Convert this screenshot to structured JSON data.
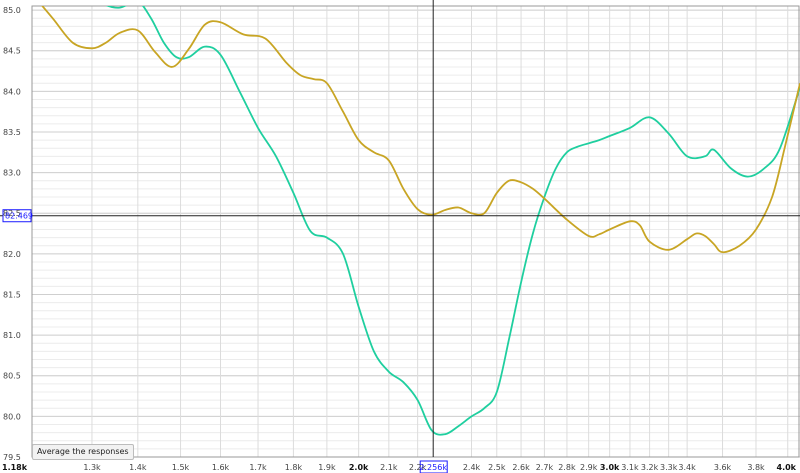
{
  "button": {
    "average_label": "Average the responses"
  },
  "cursor": {
    "x_label": "2.256k",
    "y_label": "82.469",
    "x": 2256,
    "y": 82.469
  },
  "colors": {
    "teal": "#1fcf9f",
    "gold": "#c8a524",
    "cursor_label": "#1a1aff"
  },
  "chart_data": {
    "type": "line",
    "x_scale": "log",
    "xlim": [
      1180,
      4080
    ],
    "ylim": [
      79.5,
      85.05
    ],
    "grid": true,
    "ytick_values": [
      79.5,
      80.0,
      80.5,
      81.0,
      81.5,
      82.0,
      82.5,
      83.0,
      83.5,
      84.0,
      84.5,
      85.0
    ],
    "ytick_labels": [
      "79.5",
      "80.0",
      "80.5",
      "81.0",
      "81.5",
      "82.0",
      "82.5",
      "83.0",
      "83.5",
      "84.0",
      "84.5",
      "85.0"
    ],
    "xtick_values": [
      1180,
      1300,
      1400,
      1500,
      1600,
      1700,
      1800,
      1900,
      2000,
      2100,
      2200,
      2400,
      2500,
      2600,
      2700,
      2800,
      2900,
      3000,
      3100,
      3200,
      3300,
      3400,
      3600,
      3800,
      4000
    ],
    "xtick_labels": [
      "1.18k",
      "1.3k",
      "1.4k",
      "1.5k",
      "1.6k",
      "1.7k",
      "1.8k",
      "1.9k",
      "2.0k",
      "2.1k",
      "2.2k",
      "2.4k",
      "2.5k",
      "2.6k",
      "2.7k",
      "2.8k",
      "2.9k",
      "3.0k",
      "3.1k",
      "3.2k",
      "3.3k",
      "3.4k",
      "3.6k",
      "3.8k",
      "4.0k"
    ],
    "xtick_major": [
      1180,
      2000,
      3000,
      4000
    ],
    "series": [
      {
        "color": "#1fcf9f",
        "points": [
          [
            1300,
            85.15
          ],
          [
            1330,
            85.06
          ],
          [
            1360,
            85.03
          ],
          [
            1400,
            85.1
          ],
          [
            1430,
            84.9
          ],
          [
            1460,
            84.6
          ],
          [
            1490,
            84.42
          ],
          [
            1520,
            84.42
          ],
          [
            1560,
            84.55
          ],
          [
            1600,
            84.45
          ],
          [
            1650,
            84.0
          ],
          [
            1700,
            83.55
          ],
          [
            1750,
            83.2
          ],
          [
            1800,
            82.75
          ],
          [
            1850,
            82.28
          ],
          [
            1900,
            82.2
          ],
          [
            1950,
            82.0
          ],
          [
            2000,
            81.35
          ],
          [
            2050,
            80.8
          ],
          [
            2100,
            80.55
          ],
          [
            2150,
            80.42
          ],
          [
            2200,
            80.2
          ],
          [
            2250,
            79.83
          ],
          [
            2300,
            79.78
          ],
          [
            2350,
            79.88
          ],
          [
            2400,
            80.0
          ],
          [
            2450,
            80.1
          ],
          [
            2500,
            80.3
          ],
          [
            2550,
            80.95
          ],
          [
            2600,
            81.65
          ],
          [
            2650,
            82.25
          ],
          [
            2700,
            82.7
          ],
          [
            2750,
            83.05
          ],
          [
            2800,
            83.25
          ],
          [
            2850,
            83.32
          ],
          [
            2900,
            83.36
          ],
          [
            2950,
            83.4
          ],
          [
            3000,
            83.45
          ],
          [
            3100,
            83.55
          ],
          [
            3200,
            83.68
          ],
          [
            3300,
            83.48
          ],
          [
            3400,
            83.2
          ],
          [
            3500,
            83.2
          ],
          [
            3550,
            83.28
          ],
          [
            3650,
            83.05
          ],
          [
            3750,
            82.95
          ],
          [
            3850,
            83.05
          ],
          [
            3950,
            83.3
          ],
          [
            4080,
            84.05
          ]
        ]
      },
      {
        "color": "#c8a524",
        "points": [
          [
            1180,
            85.2
          ],
          [
            1220,
            84.9
          ],
          [
            1260,
            84.6
          ],
          [
            1300,
            84.53
          ],
          [
            1330,
            84.6
          ],
          [
            1360,
            84.72
          ],
          [
            1400,
            84.75
          ],
          [
            1440,
            84.48
          ],
          [
            1480,
            84.3
          ],
          [
            1520,
            84.52
          ],
          [
            1560,
            84.82
          ],
          [
            1600,
            84.85
          ],
          [
            1660,
            84.7
          ],
          [
            1720,
            84.65
          ],
          [
            1780,
            84.35
          ],
          [
            1820,
            84.2
          ],
          [
            1860,
            84.15
          ],
          [
            1900,
            84.1
          ],
          [
            1950,
            83.75
          ],
          [
            2000,
            83.4
          ],
          [
            2050,
            83.25
          ],
          [
            2100,
            83.15
          ],
          [
            2150,
            82.8
          ],
          [
            2200,
            82.55
          ],
          [
            2250,
            82.48
          ],
          [
            2300,
            82.54
          ],
          [
            2350,
            82.57
          ],
          [
            2400,
            82.5
          ],
          [
            2450,
            82.5
          ],
          [
            2500,
            82.75
          ],
          [
            2550,
            82.9
          ],
          [
            2600,
            82.88
          ],
          [
            2650,
            82.8
          ],
          [
            2700,
            82.68
          ],
          [
            2800,
            82.42
          ],
          [
            2900,
            82.22
          ],
          [
            2950,
            82.24
          ],
          [
            3000,
            82.3
          ],
          [
            3100,
            82.4
          ],
          [
            3150,
            82.35
          ],
          [
            3200,
            82.15
          ],
          [
            3300,
            82.05
          ],
          [
            3400,
            82.18
          ],
          [
            3450,
            82.25
          ],
          [
            3500,
            82.22
          ],
          [
            3550,
            82.12
          ],
          [
            3600,
            82.02
          ],
          [
            3700,
            82.1
          ],
          [
            3800,
            82.3
          ],
          [
            3900,
            82.7
          ],
          [
            3980,
            83.3
          ],
          [
            4080,
            84.1
          ]
        ]
      }
    ]
  }
}
